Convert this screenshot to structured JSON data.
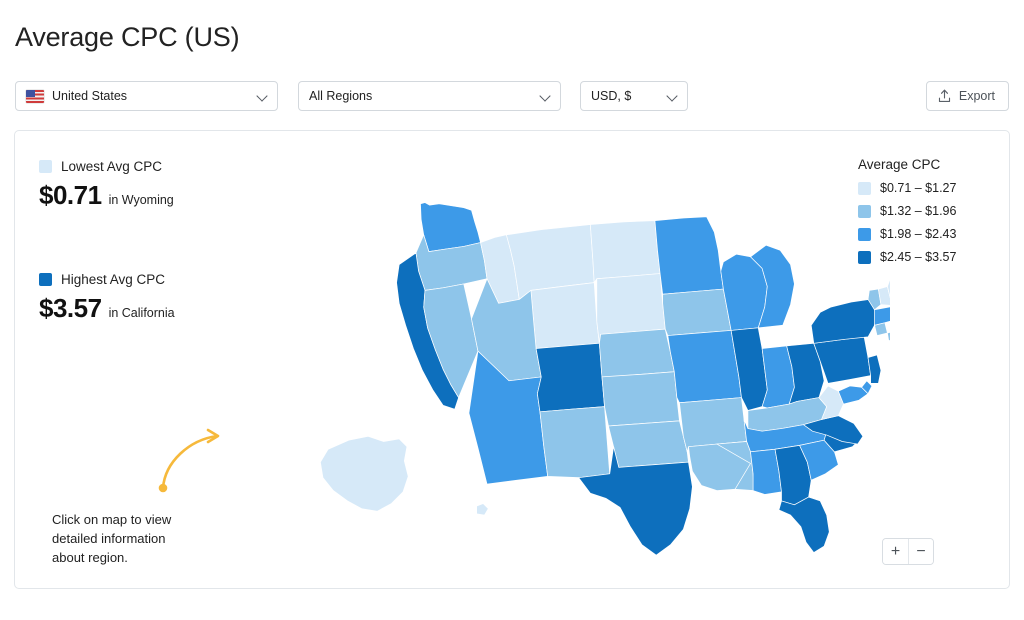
{
  "page_title": "Average CPC (US)",
  "toolbar": {
    "country_select": {
      "value": "United States",
      "icon": "us-flag-icon",
      "chevron": "chevron-down-icon"
    },
    "region_select": {
      "value": "All Regions",
      "chevron": "chevron-down-icon"
    },
    "currency_select": {
      "value": "USD, $",
      "chevron": "chevron-down-icon"
    },
    "export_button": {
      "label": "Export",
      "icon": "upload-icon"
    }
  },
  "left_legend": {
    "lowest": {
      "title": "Lowest Avg CPC",
      "amount": "$0.71",
      "where": "in Wyoming",
      "color": "#d6e9f8"
    },
    "highest": {
      "title": "Highest Avg CPC",
      "amount": "$3.57",
      "where": "in California",
      "color": "#0d6fbd"
    }
  },
  "hint": {
    "line1": "Click on map to view",
    "line2": "detailed information",
    "line3": "about region.",
    "arrow_color": "#f6b93b"
  },
  "right_legend": {
    "title": "Average CPC",
    "items": [
      {
        "label": "$0.71 – $1.27",
        "color": "#d6e9f8"
      },
      {
        "label": "$1.32 – $1.96",
        "color": "#8ec5ea"
      },
      {
        "label": "$1.98 – $2.43",
        "color": "#3d9ae8"
      },
      {
        "label": "$2.45 – $3.57",
        "color": "#0d6fbd"
      }
    ]
  },
  "zoom_controls": {
    "zoom_in": "+",
    "zoom_out": "−"
  },
  "chart_data": {
    "type": "choropleth",
    "title": "Average CPC (US)",
    "unit": "USD, $",
    "metric": "Average CPC",
    "region_scope": "United States",
    "bins": [
      {
        "label": "$0.71 – $1.27",
        "min": 0.71,
        "max": 1.27,
        "color": "#d6e9f8"
      },
      {
        "label": "$1.32 – $1.96",
        "min": 1.32,
        "max": 1.96,
        "color": "#8ec5ea"
      },
      {
        "label": "$1.98 – $2.43",
        "min": 1.98,
        "max": 2.43,
        "color": "#3d9ae8"
      },
      {
        "label": "$2.45 – $3.57",
        "min": 2.45,
        "max": 3.57,
        "color": "#0d6fbd"
      }
    ],
    "min": {
      "state": "Wyoming",
      "value": 0.71
    },
    "max": {
      "state": "California",
      "value": 3.57
    },
    "states": [
      {
        "id": "WA",
        "name": "Washington",
        "bin": 3
      },
      {
        "id": "OR",
        "name": "Oregon",
        "bin": 2
      },
      {
        "id": "CA",
        "name": "California",
        "bin": 4
      },
      {
        "id": "NV",
        "name": "Nevada",
        "bin": 2
      },
      {
        "id": "ID",
        "name": "Idaho",
        "bin": 1
      },
      {
        "id": "MT",
        "name": "Montana",
        "bin": 1
      },
      {
        "id": "WY",
        "name": "Wyoming",
        "bin": 1
      },
      {
        "id": "UT",
        "name": "Utah",
        "bin": 2
      },
      {
        "id": "AZ",
        "name": "Arizona",
        "bin": 3
      },
      {
        "id": "CO",
        "name": "Colorado",
        "bin": 4
      },
      {
        "id": "NM",
        "name": "New Mexico",
        "bin": 2
      },
      {
        "id": "ND",
        "name": "North Dakota",
        "bin": 1
      },
      {
        "id": "SD",
        "name": "South Dakota",
        "bin": 1
      },
      {
        "id": "NE",
        "name": "Nebraska",
        "bin": 2
      },
      {
        "id": "KS",
        "name": "Kansas",
        "bin": 2
      },
      {
        "id": "OK",
        "name": "Oklahoma",
        "bin": 2
      },
      {
        "id": "TX",
        "name": "Texas",
        "bin": 4
      },
      {
        "id": "MN",
        "name": "Minnesota",
        "bin": 3
      },
      {
        "id": "IA",
        "name": "Iowa",
        "bin": 2
      },
      {
        "id": "MO",
        "name": "Missouri",
        "bin": 3
      },
      {
        "id": "AR",
        "name": "Arkansas",
        "bin": 2
      },
      {
        "id": "LA",
        "name": "Louisiana",
        "bin": 2
      },
      {
        "id": "WI",
        "name": "Wisconsin",
        "bin": 3
      },
      {
        "id": "IL",
        "name": "Illinois",
        "bin": 4
      },
      {
        "id": "MI",
        "name": "Michigan",
        "bin": 3
      },
      {
        "id": "IN",
        "name": "Indiana",
        "bin": 3
      },
      {
        "id": "OH",
        "name": "Ohio",
        "bin": 4
      },
      {
        "id": "KY",
        "name": "Kentucky",
        "bin": 2
      },
      {
        "id": "TN",
        "name": "Tennessee",
        "bin": 3
      },
      {
        "id": "MS",
        "name": "Mississippi",
        "bin": 2
      },
      {
        "id": "AL",
        "name": "Alabama",
        "bin": 3
      },
      {
        "id": "GA",
        "name": "Georgia",
        "bin": 4
      },
      {
        "id": "FL",
        "name": "Florida",
        "bin": 4
      },
      {
        "id": "SC",
        "name": "South Carolina",
        "bin": 3
      },
      {
        "id": "NC",
        "name": "North Carolina",
        "bin": 4
      },
      {
        "id": "VA",
        "name": "Virginia",
        "bin": 4
      },
      {
        "id": "WV",
        "name": "West Virginia",
        "bin": 1
      },
      {
        "id": "MD",
        "name": "Maryland",
        "bin": 3
      },
      {
        "id": "DE",
        "name": "Delaware",
        "bin": 3
      },
      {
        "id": "PA",
        "name": "Pennsylvania",
        "bin": 4
      },
      {
        "id": "NJ",
        "name": "New Jersey",
        "bin": 4
      },
      {
        "id": "NY",
        "name": "New York",
        "bin": 4
      },
      {
        "id": "CT",
        "name": "Connecticut",
        "bin": 2
      },
      {
        "id": "RI",
        "name": "Rhode Island",
        "bin": 2
      },
      {
        "id": "MA",
        "name": "Massachusetts",
        "bin": 3
      },
      {
        "id": "VT",
        "name": "Vermont",
        "bin": 2
      },
      {
        "id": "NH",
        "name": "New Hampshire",
        "bin": 1
      },
      {
        "id": "ME",
        "name": "Maine",
        "bin": 1
      },
      {
        "id": "AK",
        "name": "Alaska",
        "bin": 1
      },
      {
        "id": "HI",
        "name": "Hawaii",
        "bin": 1
      }
    ]
  }
}
